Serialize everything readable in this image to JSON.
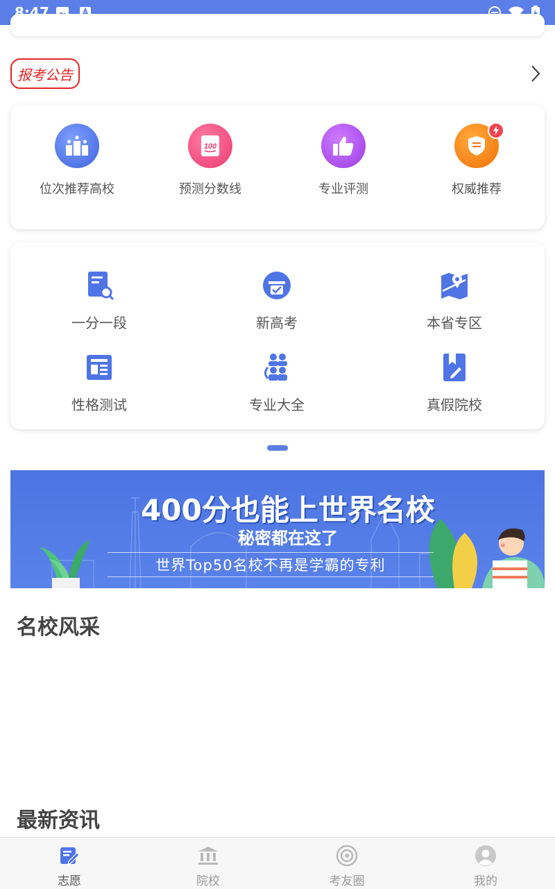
{
  "status_bar": {
    "time": "8:47"
  },
  "notice": {
    "badge": "报考公告"
  },
  "features": [
    {
      "label": "位次推荐高校",
      "icon": "podium-stars-icon",
      "color": "#4f74e6"
    },
    {
      "label": "预测分数线",
      "icon": "score-100-icon",
      "color": "#f0467a"
    },
    {
      "label": "专业评测",
      "icon": "thumbs-up-icon",
      "color": "#a64be8"
    },
    {
      "label": "权威推荐",
      "icon": "shield-badge-icon",
      "color": "#f47b0e"
    }
  ],
  "tools": [
    {
      "label": "一分一段",
      "icon": "document-search-icon"
    },
    {
      "label": "新高考",
      "icon": "printer-check-icon"
    },
    {
      "label": "本省专区",
      "icon": "map-pin-icon"
    },
    {
      "label": "性格测试",
      "icon": "newspaper-icon"
    },
    {
      "label": "专业大全",
      "icon": "group-people-icon"
    },
    {
      "label": "真假院校",
      "icon": "bookmark-edit-icon"
    }
  ],
  "banner": {
    "headline": "400分也能上世界名校",
    "sub": "秘密都在这了",
    "tagline": "世界Top50名校不再是学霸的专利"
  },
  "sections": {
    "famous_schools": "名校风采",
    "latest_news": "最新资讯"
  },
  "tabs": [
    {
      "label": "志愿",
      "icon": "edit-form-icon",
      "active": true
    },
    {
      "label": "院校",
      "icon": "institution-icon",
      "active": false
    },
    {
      "label": "考友圈",
      "icon": "target-circle-icon",
      "active": false
    },
    {
      "label": "我的",
      "icon": "user-avatar-icon",
      "active": false
    }
  ],
  "colors": {
    "primary": "#5b7fe6",
    "notice_red": "#e32424",
    "inactive": "#9a9a9a"
  }
}
